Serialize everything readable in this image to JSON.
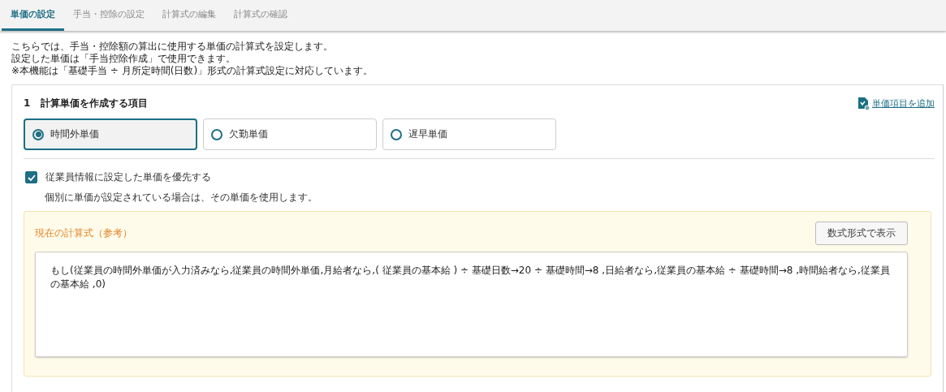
{
  "tabs": [
    {
      "label": "単価の設定",
      "selected": true
    },
    {
      "label": "手当・控除の設定",
      "selected": false
    },
    {
      "label": "計算式の編集",
      "selected": false
    },
    {
      "label": "計算式の確認",
      "selected": false
    }
  ],
  "intro": [
    "こちらでは、手当・控除額の算出に使用する単価の計算式を設定します。",
    "設定した単価は「手当控除作成」で使用できます。",
    "※本機能は「基礎手当 ÷ 月所定時間(日数)」形式の計算式設定に対応しています。"
  ],
  "section": {
    "number": "1",
    "title": "計算単価を作成する項目",
    "add_link": "単価項目を追加",
    "options": [
      {
        "label": "時間外単価",
        "selected": true
      },
      {
        "label": "欠勤単価",
        "selected": false
      },
      {
        "label": "遅早単価",
        "selected": false
      }
    ],
    "priority": {
      "label": "従業員情報に設定した単価を優先する",
      "checked": true,
      "note": "個別に単価が設定されている場合は、その単価を使用します。"
    },
    "formula": {
      "title": "現在の計算式（参考）",
      "button": "数式形式で表示",
      "text": "もし(従業員の時間外単価が入力済みなら,従業員の時間外単価,月給者なら,( 従業員の基本給 ) ÷ 基礎日数→20 ÷ 基礎時間→8 ,日給者なら,従業員の基本給 ÷ 基礎時間→8 ,時間給者なら,従業員の基本給  ,0)"
    }
  }
}
